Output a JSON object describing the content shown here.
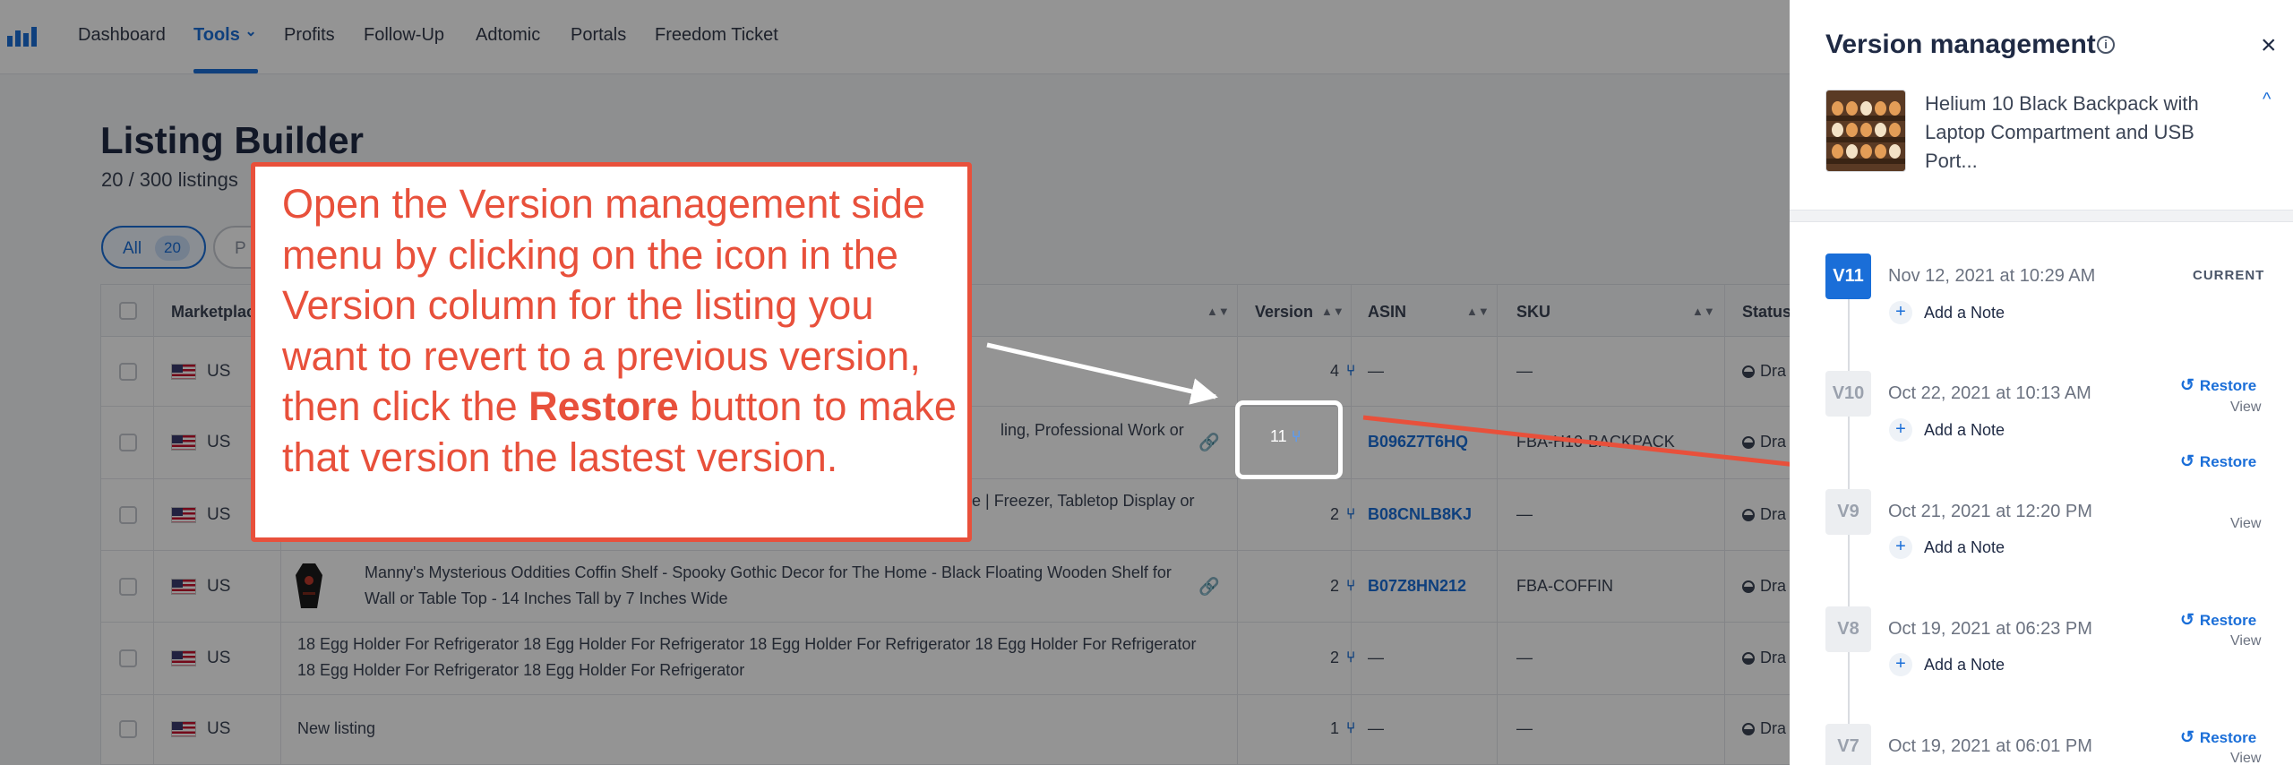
{
  "nav": {
    "items": [
      "Dashboard",
      "Tools",
      "Profits",
      "Follow-Up",
      "Adtomic",
      "Portals",
      "Freedom Ticket"
    ],
    "active": "Tools",
    "logo_icon": "helium10-logo-icon",
    "tools_chevron": "⌄"
  },
  "page": {
    "title": "Listing Builder",
    "subtitle": "20 / 300 listings",
    "filter_all_label": "All",
    "filter_all_count": "20",
    "filter_partial_label": "P"
  },
  "table": {
    "columns": {
      "marketplace": "Marketplac",
      "version": "Version",
      "asin": "ASIN",
      "sku": "SKU",
      "status": "Status"
    },
    "rows": [
      {
        "marketplace": "US",
        "title": "",
        "version": "4",
        "asin": "—",
        "sku": "—",
        "status": "Dra"
      },
      {
        "marketplace": "US",
        "title": "ling, Professional Work or",
        "version": "11",
        "asin": "B096Z7T6HQ",
        "sku": "FBA-H10-BACKPACK",
        "status": "Dra"
      },
      {
        "marketplace": "US",
        "title": "e | Freezer, Tabletop Display or",
        "version": "2",
        "asin": "B08CNLB8KJ",
        "sku": "—",
        "status": "Dra"
      },
      {
        "marketplace": "US",
        "title": "Manny's Mysterious Oddities Coffin Shelf - Spooky Gothic Decor for The Home - Black Floating Wooden Shelf for Wall or Table Top - 14 Inches Tall by 7 Inches Wide",
        "version": "2",
        "asin": "B07Z8HN212",
        "sku": "FBA-COFFIN",
        "status": "Dra"
      },
      {
        "marketplace": "US",
        "title": "18 Egg Holder For Refrigerator 18 Egg Holder For Refrigerator 18 Egg Holder For Refrigerator 18 Egg Holder For Refrigerator 18 Egg Holder For Refrigerator 18 Egg Holder For Refrigerator",
        "version": "2",
        "asin": "—",
        "sku": "—",
        "status": "Dra"
      },
      {
        "marketplace": "US",
        "title": "New listing",
        "version": "1",
        "asin": "—",
        "sku": "—",
        "status": "Dra"
      }
    ]
  },
  "callout": {
    "text_before": "Open the Version management side menu by clicking on the icon in the Version column for the listing you want to revert to a previous version, then click the ",
    "bold": "Restore",
    "text_after": " button to make that version the lastest version.",
    "color": "#e8503b"
  },
  "panel": {
    "title": "Version management",
    "info_icon": "i",
    "close_icon": "×",
    "product_name": "Helium 10 Black Backpack with Laptop Compartment and USB Port...",
    "collapse_icon": "^",
    "current_label": "CURRENT",
    "add_note_label": "Add a Note",
    "restore_label": "Restore",
    "view_label": "View",
    "versions": [
      {
        "label": "V11",
        "date": "Nov 12, 2021 at 10:29 AM",
        "current": true
      },
      {
        "label": "V10",
        "date": "Oct 22, 2021 at 10:13 AM",
        "current": false
      },
      {
        "label": "V9",
        "date": "Oct 21, 2021 at 12:20 PM",
        "current": false
      },
      {
        "label": "V8",
        "date": "Oct 19, 2021 at 06:23 PM",
        "current": false
      },
      {
        "label": "V7",
        "date": "Oct 19, 2021 at 06:01 PM",
        "current": false
      }
    ]
  },
  "colors": {
    "accent": "#1a6ed8",
    "annotation": "#e8503b"
  }
}
